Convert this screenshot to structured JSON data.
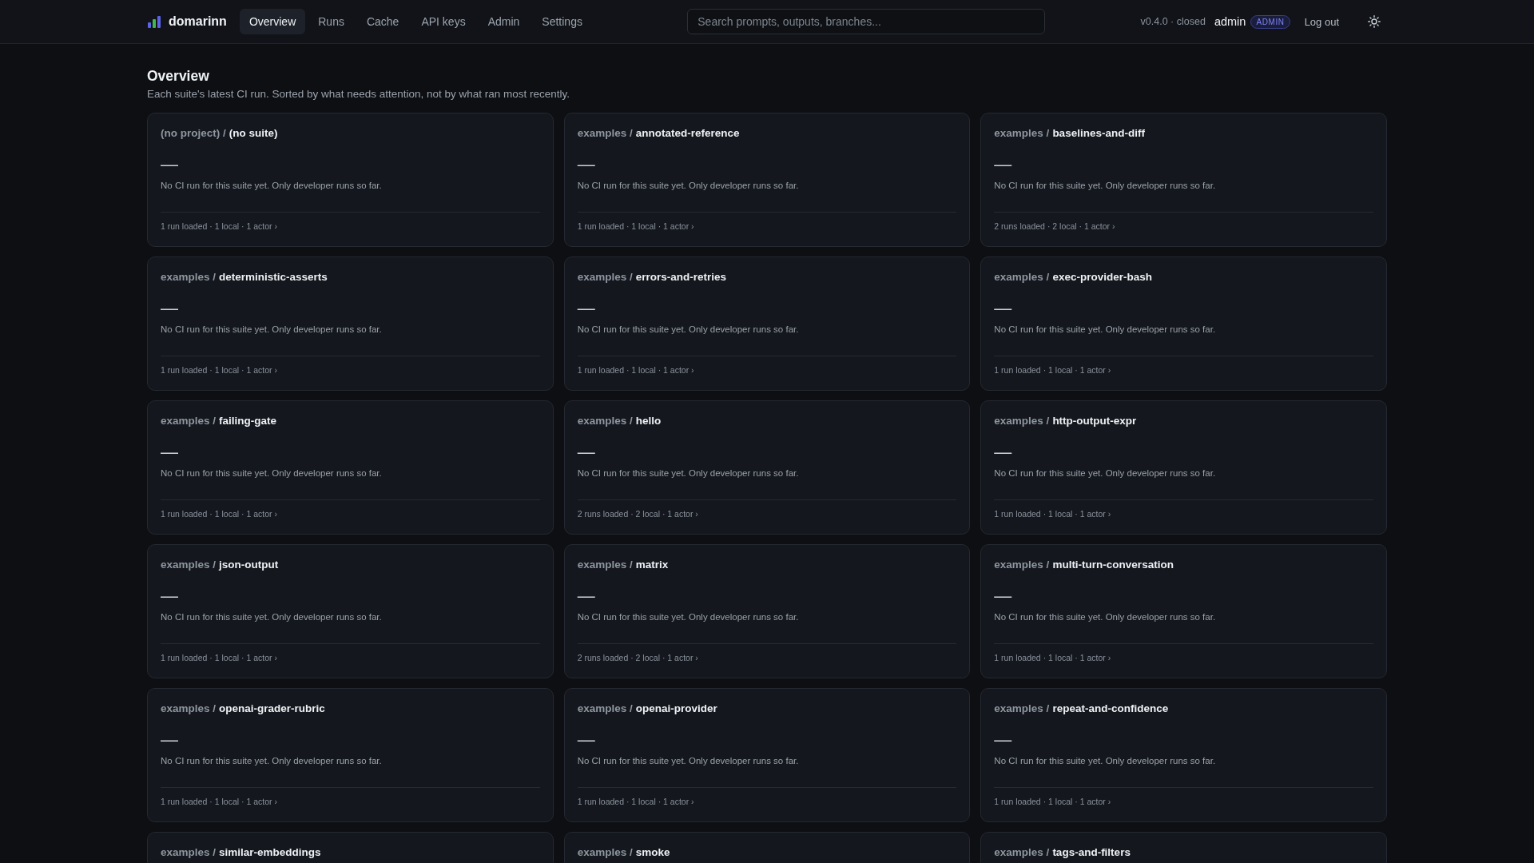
{
  "header": {
    "brand": "domarinn",
    "nav": [
      {
        "label": "Overview",
        "selected": true
      },
      {
        "label": "Runs",
        "selected": false
      },
      {
        "label": "Cache",
        "selected": false
      },
      {
        "label": "API keys",
        "selected": false
      },
      {
        "label": "Admin",
        "selected": false
      },
      {
        "label": "Settings",
        "selected": false
      }
    ],
    "search": {
      "placeholder": "Search prompts, outputs, branches..."
    },
    "version": "v0.4.0 · closed",
    "user": {
      "name": "admin",
      "role_badge": "ADMIN"
    },
    "logout": "Log out"
  },
  "page": {
    "title": "Overview",
    "subtitle": "Each suite's latest CI run. Sorted by what needs attention, not by what ran most recently."
  },
  "suites": [
    {
      "project": "(no project) /",
      "suite": "(no suite)",
      "value": "—",
      "description": "No CI run for this suite yet. Only developer runs so far.",
      "footer": "1 run loaded · 1 local · 1 actor ›"
    },
    {
      "project": "examples /",
      "suite": "annotated-reference",
      "value": "—",
      "description": "No CI run for this suite yet. Only developer runs so far.",
      "footer": "1 run loaded · 1 local · 1 actor ›"
    },
    {
      "project": "examples /",
      "suite": "baselines-and-diff",
      "value": "—",
      "description": "No CI run for this suite yet. Only developer runs so far.",
      "footer": "2 runs loaded · 2 local · 1 actor ›"
    },
    {
      "project": "examples /",
      "suite": "deterministic-asserts",
      "value": "—",
      "description": "No CI run for this suite yet. Only developer runs so far.",
      "footer": "1 run loaded · 1 local · 1 actor ›"
    },
    {
      "project": "examples /",
      "suite": "errors-and-retries",
      "value": "—",
      "description": "No CI run for this suite yet. Only developer runs so far.",
      "footer": "1 run loaded · 1 local · 1 actor ›"
    },
    {
      "project": "examples /",
      "suite": "exec-provider-bash",
      "value": "—",
      "description": "No CI run for this suite yet. Only developer runs so far.",
      "footer": "1 run loaded · 1 local · 1 actor ›"
    },
    {
      "project": "examples /",
      "suite": "failing-gate",
      "value": "—",
      "description": "No CI run for this suite yet. Only developer runs so far.",
      "footer": "1 run loaded · 1 local · 1 actor ›"
    },
    {
      "project": "examples /",
      "suite": "hello",
      "value": "—",
      "description": "No CI run for this suite yet. Only developer runs so far.",
      "footer": "2 runs loaded · 2 local · 1 actor ›"
    },
    {
      "project": "examples /",
      "suite": "http-output-expr",
      "value": "—",
      "description": "No CI run for this suite yet. Only developer runs so far.",
      "footer": "1 run loaded · 1 local · 1 actor ›"
    },
    {
      "project": "examples /",
      "suite": "json-output",
      "value": "—",
      "description": "No CI run for this suite yet. Only developer runs so far.",
      "footer": "1 run loaded · 1 local · 1 actor ›"
    },
    {
      "project": "examples /",
      "suite": "matrix",
      "value": "—",
      "description": "No CI run for this suite yet. Only developer runs so far.",
      "footer": "2 runs loaded · 2 local · 1 actor ›"
    },
    {
      "project": "examples /",
      "suite": "multi-turn-conversation",
      "value": "—",
      "description": "No CI run for this suite yet. Only developer runs so far.",
      "footer": "1 run loaded · 1 local · 1 actor ›"
    },
    {
      "project": "examples /",
      "suite": "openai-grader-rubric",
      "value": "—",
      "description": "No CI run for this suite yet. Only developer runs so far.",
      "footer": "1 run loaded · 1 local · 1 actor ›"
    },
    {
      "project": "examples /",
      "suite": "openai-provider",
      "value": "—",
      "description": "No CI run for this suite yet. Only developer runs so far.",
      "footer": "1 run loaded · 1 local · 1 actor ›"
    },
    {
      "project": "examples /",
      "suite": "repeat-and-confidence",
      "value": "—",
      "description": "No CI run for this suite yet. Only developer runs so far.",
      "footer": "1 run loaded · 1 local · 1 actor ›"
    },
    {
      "project": "examples /",
      "suite": "similar-embeddings"
    },
    {
      "project": "examples /",
      "suite": "smoke"
    },
    {
      "project": "examples /",
      "suite": "tags-and-filters"
    }
  ]
}
